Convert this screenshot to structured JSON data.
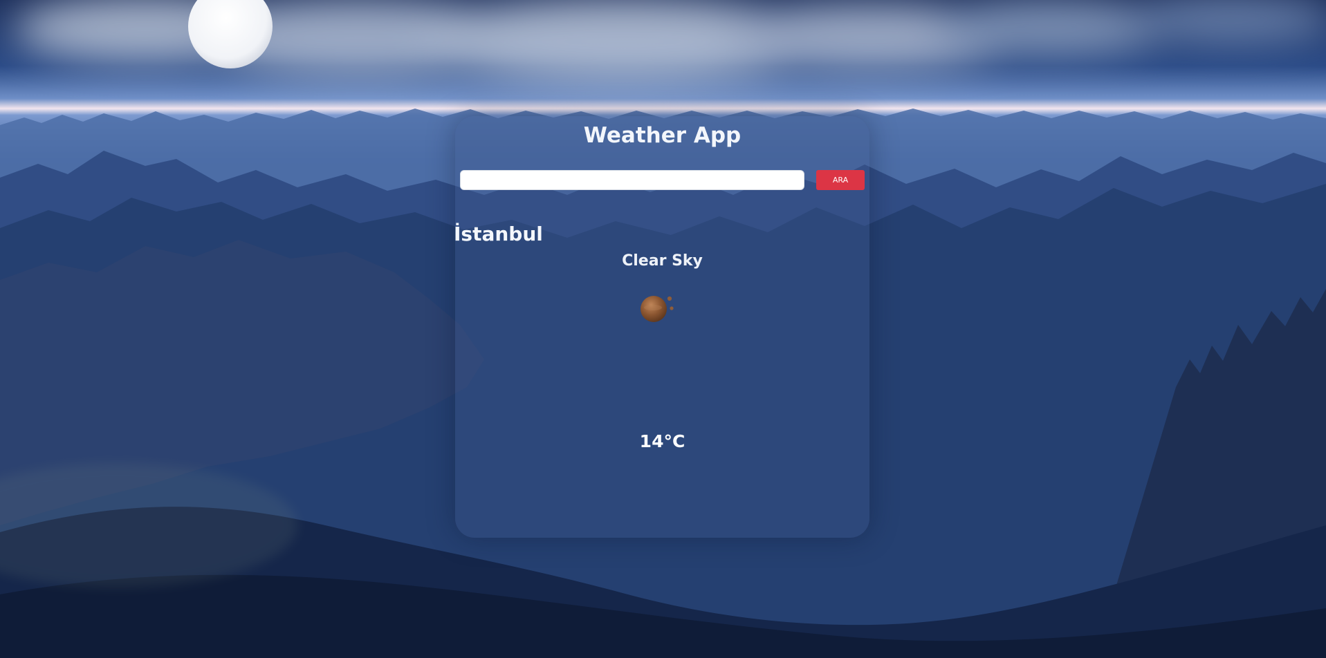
{
  "app": {
    "title": "Weather App"
  },
  "search": {
    "value": "",
    "placeholder": "",
    "button_label": "ARA"
  },
  "weather": {
    "city": "İstanbul",
    "condition": "Clear Sky",
    "icon": "clear-sky-planet-icon",
    "temperature": "14°C"
  },
  "colors": {
    "button": "#dc3545",
    "card": "rgba(60, 88, 140, 0.38)",
    "text": "#ffffff"
  }
}
